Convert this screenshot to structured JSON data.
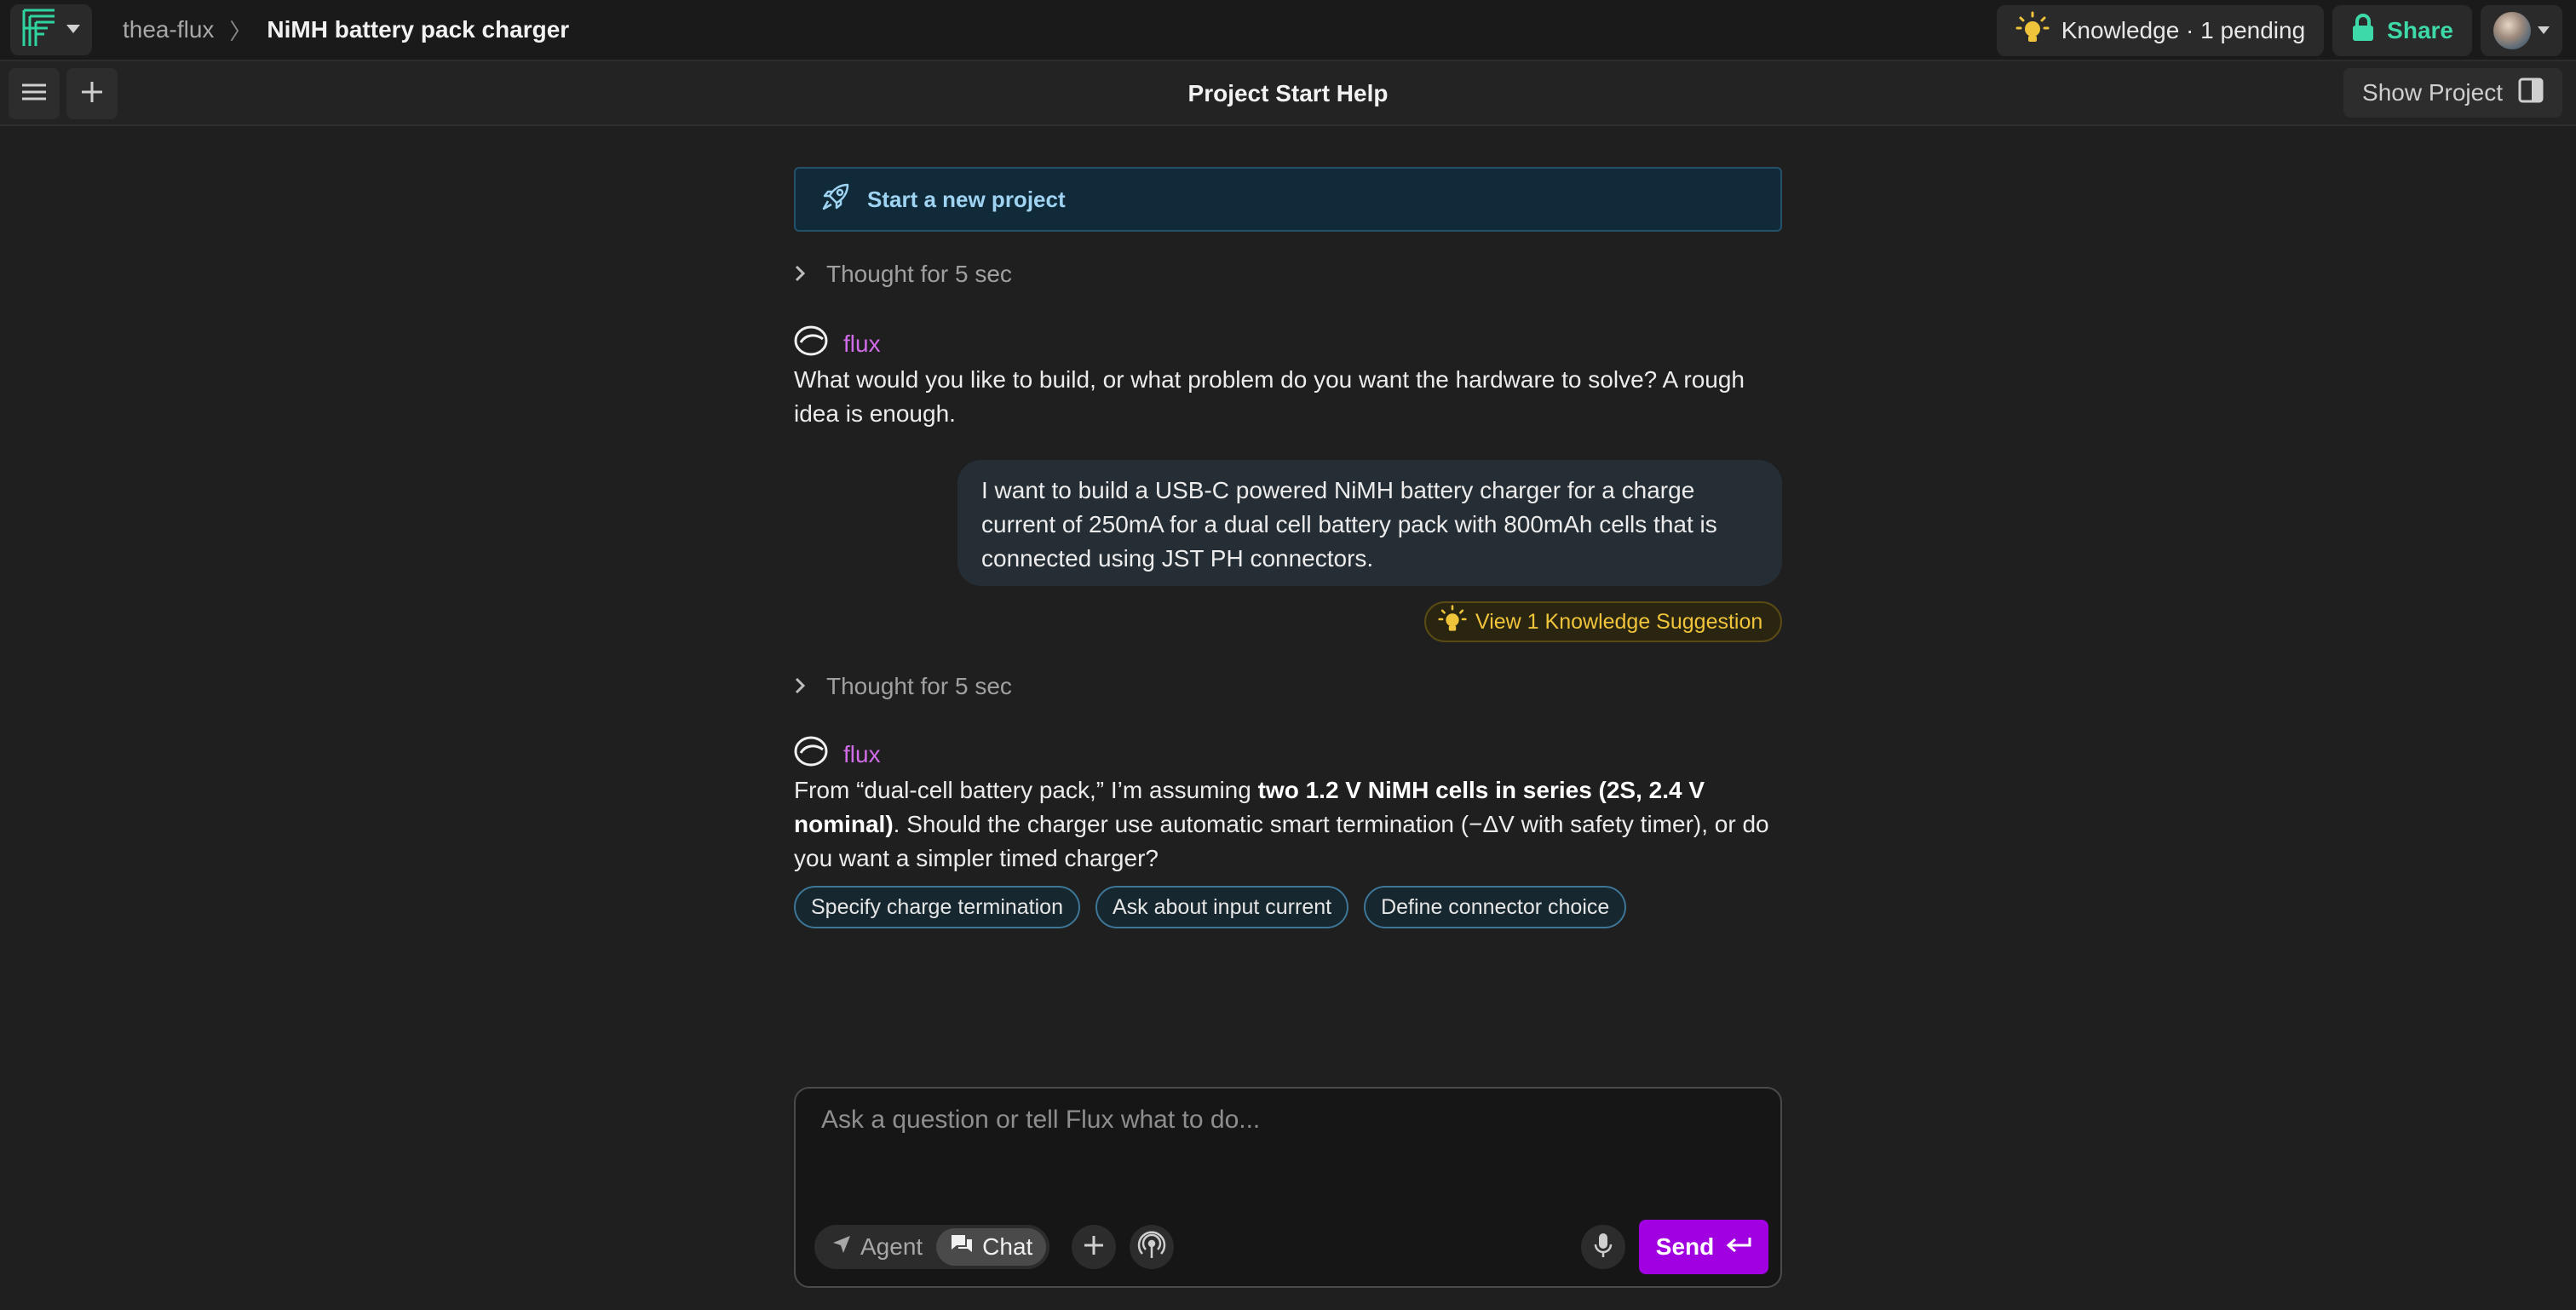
{
  "breadcrumb": {
    "user": "thea-flux",
    "separator": "〉",
    "project": "NiMH battery pack charger"
  },
  "header": {
    "knowledge_label": "Knowledge · 1 pending",
    "share_label": "Share"
  },
  "subbar": {
    "title": "Project Start Help",
    "show_project_label": "Show Project"
  },
  "chat": {
    "banner_label": "Start a new project",
    "thought_1": "Thought for 5 sec",
    "assistant_name": "flux",
    "assistant_msg_1": "What would you like to build, or what problem do you want the hardware to solve? A rough idea is enough.",
    "user_msg": "I want to build a USB-C powered NiMH battery charger for a charge current of 250mA for a dual cell battery pack with 800mAh cells that is connected using JST PH connectors.",
    "knowledge_suggestion": "View 1 Knowledge Suggestion",
    "thought_2": "Thought for 5 sec",
    "assistant_msg_2": {
      "part1": "From “dual-cell battery pack,” I’m assuming ",
      "bold": "two 1.2 V NiMH cells in series (2S, 2.4 V nominal)",
      "part2": ". Should the charger use automatic smart termination (−ΔV with safety timer), or do you want a simpler timed charger?"
    },
    "chips": [
      "Specify charge termination",
      "Ask about input current",
      "Define connector choice"
    ]
  },
  "composer": {
    "placeholder": "Ask a question or tell Flux what to do...",
    "value": "",
    "mode_agent": "Agent",
    "mode_chat": "Chat",
    "active_mode": "Chat",
    "send_label": "Send"
  },
  "colors": {
    "accent_purple": "#a100e0",
    "assistant_name": "#d16ce8",
    "share_green": "#3ed9a8",
    "logo_green": "#2fd3a0",
    "knowledge_yellow": "#f0c43a"
  },
  "icons": {
    "logo": "flux-logo-icon",
    "knowledge": "lightbulb-icon",
    "share": "lock-icon",
    "menu": "hamburger-icon",
    "new": "plus-icon",
    "show_project": "panel-icon",
    "banner": "rocket-icon",
    "thought": "chevron-right-icon",
    "assistant": "flux-avatar-icon",
    "agent": "send-arrow-icon",
    "chat": "chat-icon",
    "attach": "plus-icon",
    "live": "broadcast-icon",
    "mic": "microphone-icon",
    "send": "return-icon"
  }
}
